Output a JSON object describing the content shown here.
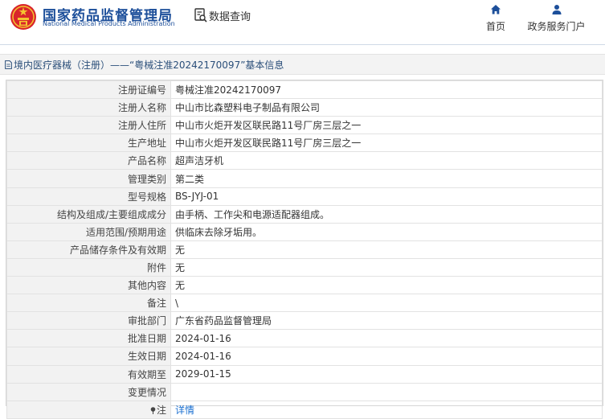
{
  "header": {
    "org_cn": "国家药品监督管理局",
    "org_en": "National Medical Products Administration",
    "query_label": "数据查询",
    "nav": [
      {
        "label": "首页",
        "icon": "home-icon"
      },
      {
        "label": "政务服务门户",
        "icon": "user-icon"
      }
    ]
  },
  "breadcrumb": {
    "text": "境内医疗器械（注册）——“粤械注准20242170097”基本信息"
  },
  "details": {
    "rows": [
      {
        "key": "注册证编号",
        "value": "粤械注准20242170097"
      },
      {
        "key": "注册人名称",
        "value": "中山市比森塑料电子制品有限公司"
      },
      {
        "key": "注册人住所",
        "value": "中山市火炬开发区联民路11号厂房三层之一"
      },
      {
        "key": "生产地址",
        "value": "中山市火炬开发区联民路11号厂房三层之一"
      },
      {
        "key": "产品名称",
        "value": "超声洁牙机"
      },
      {
        "key": "管理类别",
        "value": "第二类"
      },
      {
        "key": "型号规格",
        "value": "BS-JYJ-01"
      },
      {
        "key": "结构及组成/主要组成成分",
        "value": "由手柄、工作尖和电源适配器组成。"
      },
      {
        "key": "适用范围/预期用途",
        "value": "供临床去除牙垢用。"
      },
      {
        "key": "产品储存条件及有效期",
        "value": "无"
      },
      {
        "key": "附件",
        "value": "无"
      },
      {
        "key": "其他内容",
        "value": "无"
      },
      {
        "key": "备注",
        "value": "\\"
      },
      {
        "key": "审批部门",
        "value": "广东省药品监督管理局"
      },
      {
        "key": "批准日期",
        "value": "2024-01-16"
      },
      {
        "key": "生效日期",
        "value": "2024-01-16"
      },
      {
        "key": "有效期至",
        "value": "2029-01-15"
      },
      {
        "key": "变更情况",
        "value": ""
      }
    ],
    "note_key": "注",
    "note_link": "详情"
  },
  "colors": {
    "brand_blue": "#1d4f9a",
    "link_blue": "#1a6fd0",
    "key_bg": "#f2f2f2"
  }
}
